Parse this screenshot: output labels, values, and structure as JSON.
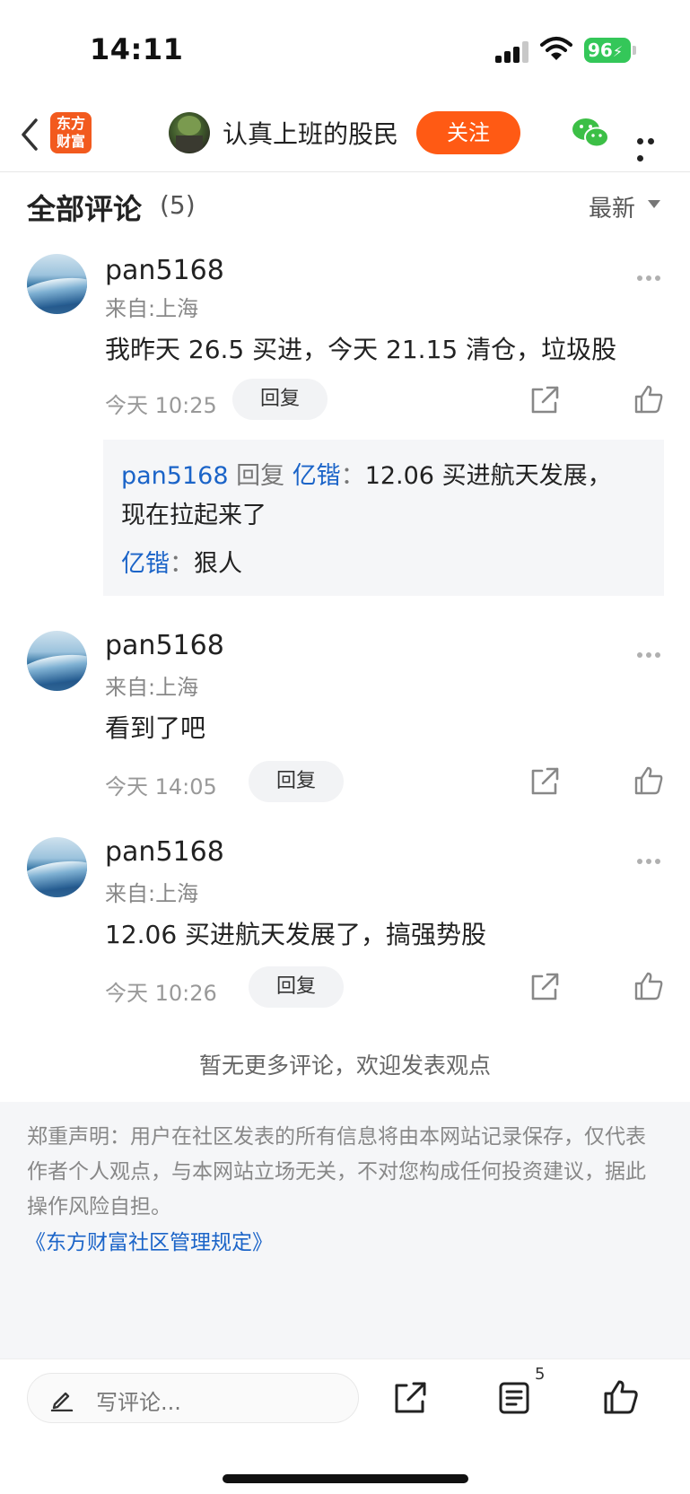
{
  "status_bar": {
    "time": "14:11",
    "battery": "96"
  },
  "header": {
    "logo_line1": "东方",
    "logo_line2": "财富",
    "author_name": "认真上班的股民",
    "follow_label": "关注"
  },
  "section": {
    "title": "全部评论",
    "count": "(5)",
    "sort_label": "最新"
  },
  "comments": [
    {
      "name": "pan5168",
      "from": "来自:上海",
      "text": "我昨天 26.5 买进，今天 21.15 清仓，垃圾股",
      "time": "今天 10:25",
      "reply_label": "回复",
      "replies": {
        "r1_user": "pan5168",
        "r1_word": " 回复 ",
        "r1_target": "亿锴",
        "r1_sep": "：",
        "r1_text_a": "12.06 买进航天发展，",
        "r1_text_b": "现在拉起来了",
        "r2_user": "亿锴",
        "r2_sep": "：",
        "r2_text": "狠人"
      }
    },
    {
      "name": "pan5168",
      "from": "来自:上海",
      "text": "看到了吧",
      "time": "今天 14:05",
      "reply_label": "回复"
    },
    {
      "name": "pan5168",
      "from": "来自:上海",
      "text": "12.06 买进航天发展了，搞强势股",
      "time": "今天 10:26",
      "reply_label": "回复"
    }
  ],
  "no_more": "暂无更多评论，欢迎发表观点",
  "disclaimer": {
    "text": "郑重声明：用户在社区发表的所有信息将由本网站记录保存，仅代表作者个人观点，与本网站立场无关，不对您构成任何投资建议，据此操作风险自担。",
    "link": "《东方财富社区管理规定》"
  },
  "bottom_bar": {
    "placeholder": "写评论...",
    "comment_count": "5"
  },
  "colors": {
    "accent": "#ff5a14",
    "link": "#1b64c8",
    "battery": "#34c759"
  }
}
